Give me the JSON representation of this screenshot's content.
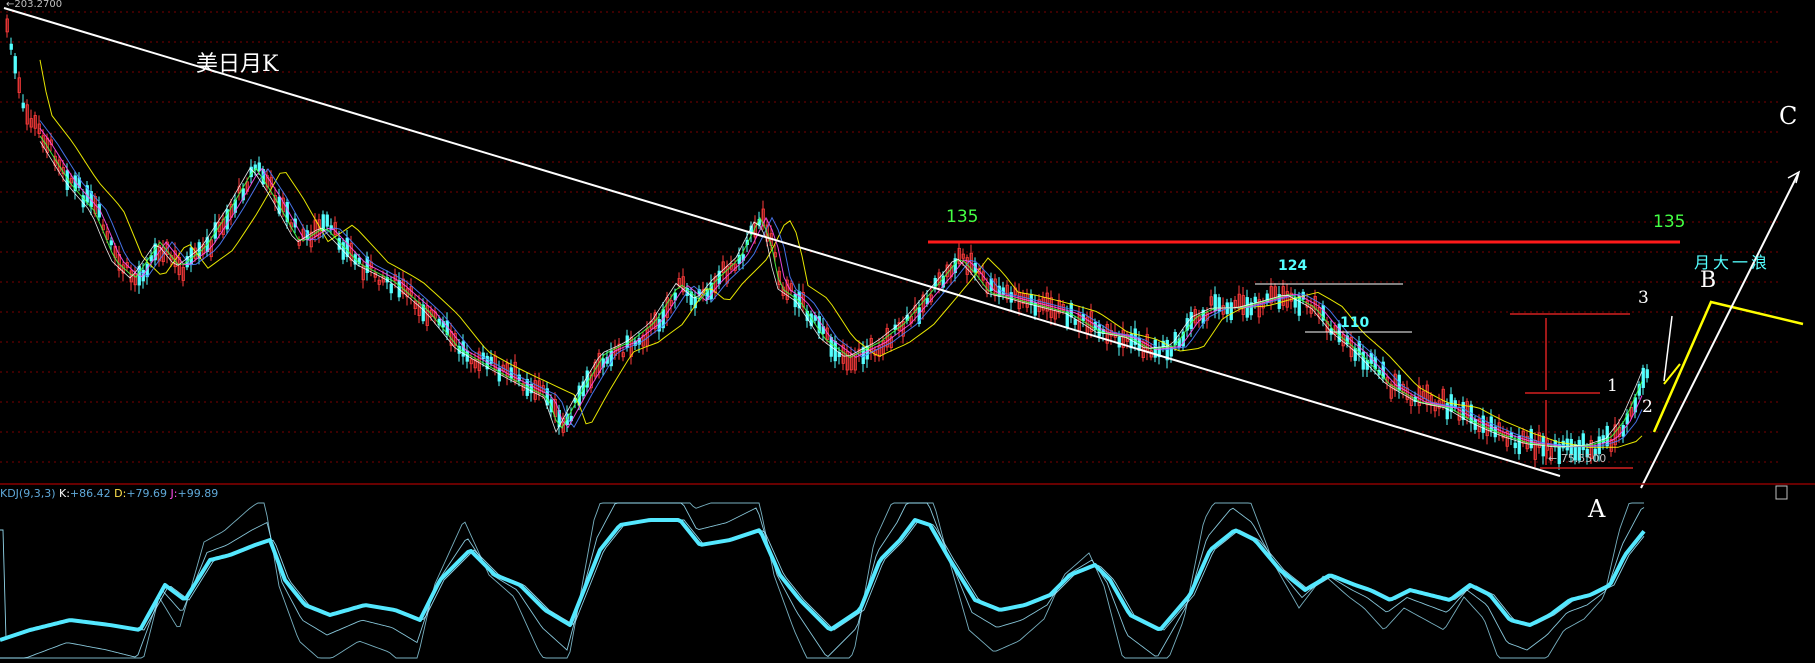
{
  "colors": {
    "background": "#000000",
    "up_candle": "#ff3b3b",
    "down_candle": "#54ffff",
    "grid": "#7a0000",
    "trendline": "#ffffff",
    "level_135": "#ff1a1a",
    "wave_yellow": "#ffff00",
    "kdj_main": "#54e8ff"
  },
  "chart_data": {
    "type": "candlestick",
    "title": "美日月K",
    "price_range": [
      75.55,
      203.27
    ],
    "y_axis_max_label": "203.2700",
    "low_marker_label": "75.5500",
    "levels": [
      {
        "label": "135",
        "value": 135
      },
      {
        "label": "124",
        "value": 124
      },
      {
        "label": "110",
        "value": 110
      }
    ],
    "wave_labels": [
      "1",
      "2",
      "3",
      "A",
      "B",
      "C"
    ],
    "annotation": "月大一浪",
    "indicator": {
      "name": "KDJ(9,3,3)",
      "K": {
        "label": "K:",
        "value": "+86.42"
      },
      "D": {
        "label": "D:",
        "value": "+79.69"
      },
      "J": {
        "label": "J:",
        "value": "+99.89"
      },
      "range": [
        0,
        100
      ]
    },
    "grid": true
  }
}
